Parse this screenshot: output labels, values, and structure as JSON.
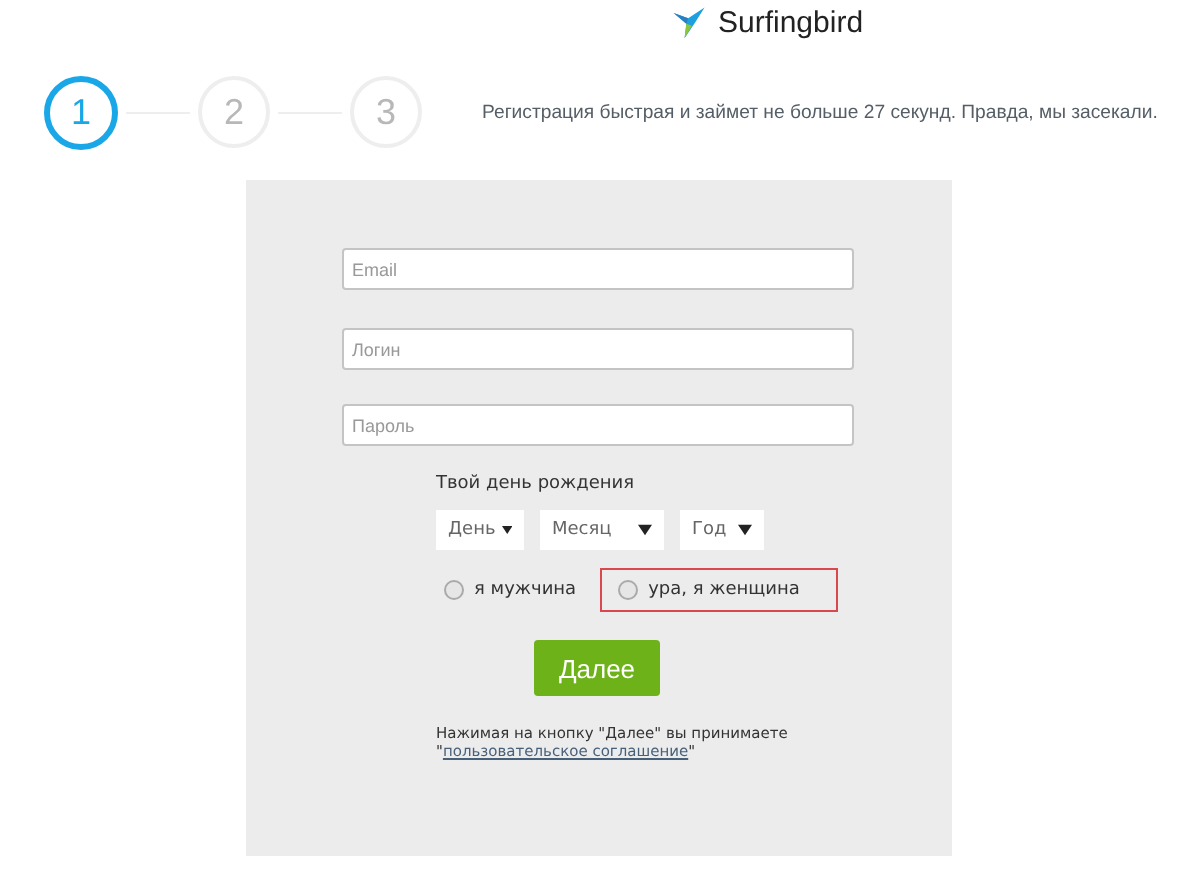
{
  "logo": {
    "text": "Surfingbird"
  },
  "steps": [
    {
      "label": "1",
      "active": true
    },
    {
      "label": "2",
      "active": false
    },
    {
      "label": "3",
      "active": false
    }
  ],
  "tagline": "Регистрация быстрая и займет не больше 27 секунд. Правда, мы засекали.",
  "fields": [
    {
      "placeholder": "Email"
    },
    {
      "placeholder": "Логин"
    },
    {
      "placeholder": "Пароль"
    }
  ],
  "birthday": {
    "label": "Твой день рождения",
    "selects": [
      {
        "value": "День"
      },
      {
        "value": "Месяц"
      },
      {
        "value": "Год"
      }
    ]
  },
  "gender": [
    {
      "label": "я мужчина",
      "selected": false,
      "highlighted": false
    },
    {
      "label": "ура, я женщина",
      "selected": false,
      "highlighted": true
    }
  ],
  "submit": "Далее",
  "terms": {
    "before": "Нажимая на кнопку \"Далее\" вы принимаете \"",
    "link": "пользовательское соглашение",
    "after": "\""
  }
}
